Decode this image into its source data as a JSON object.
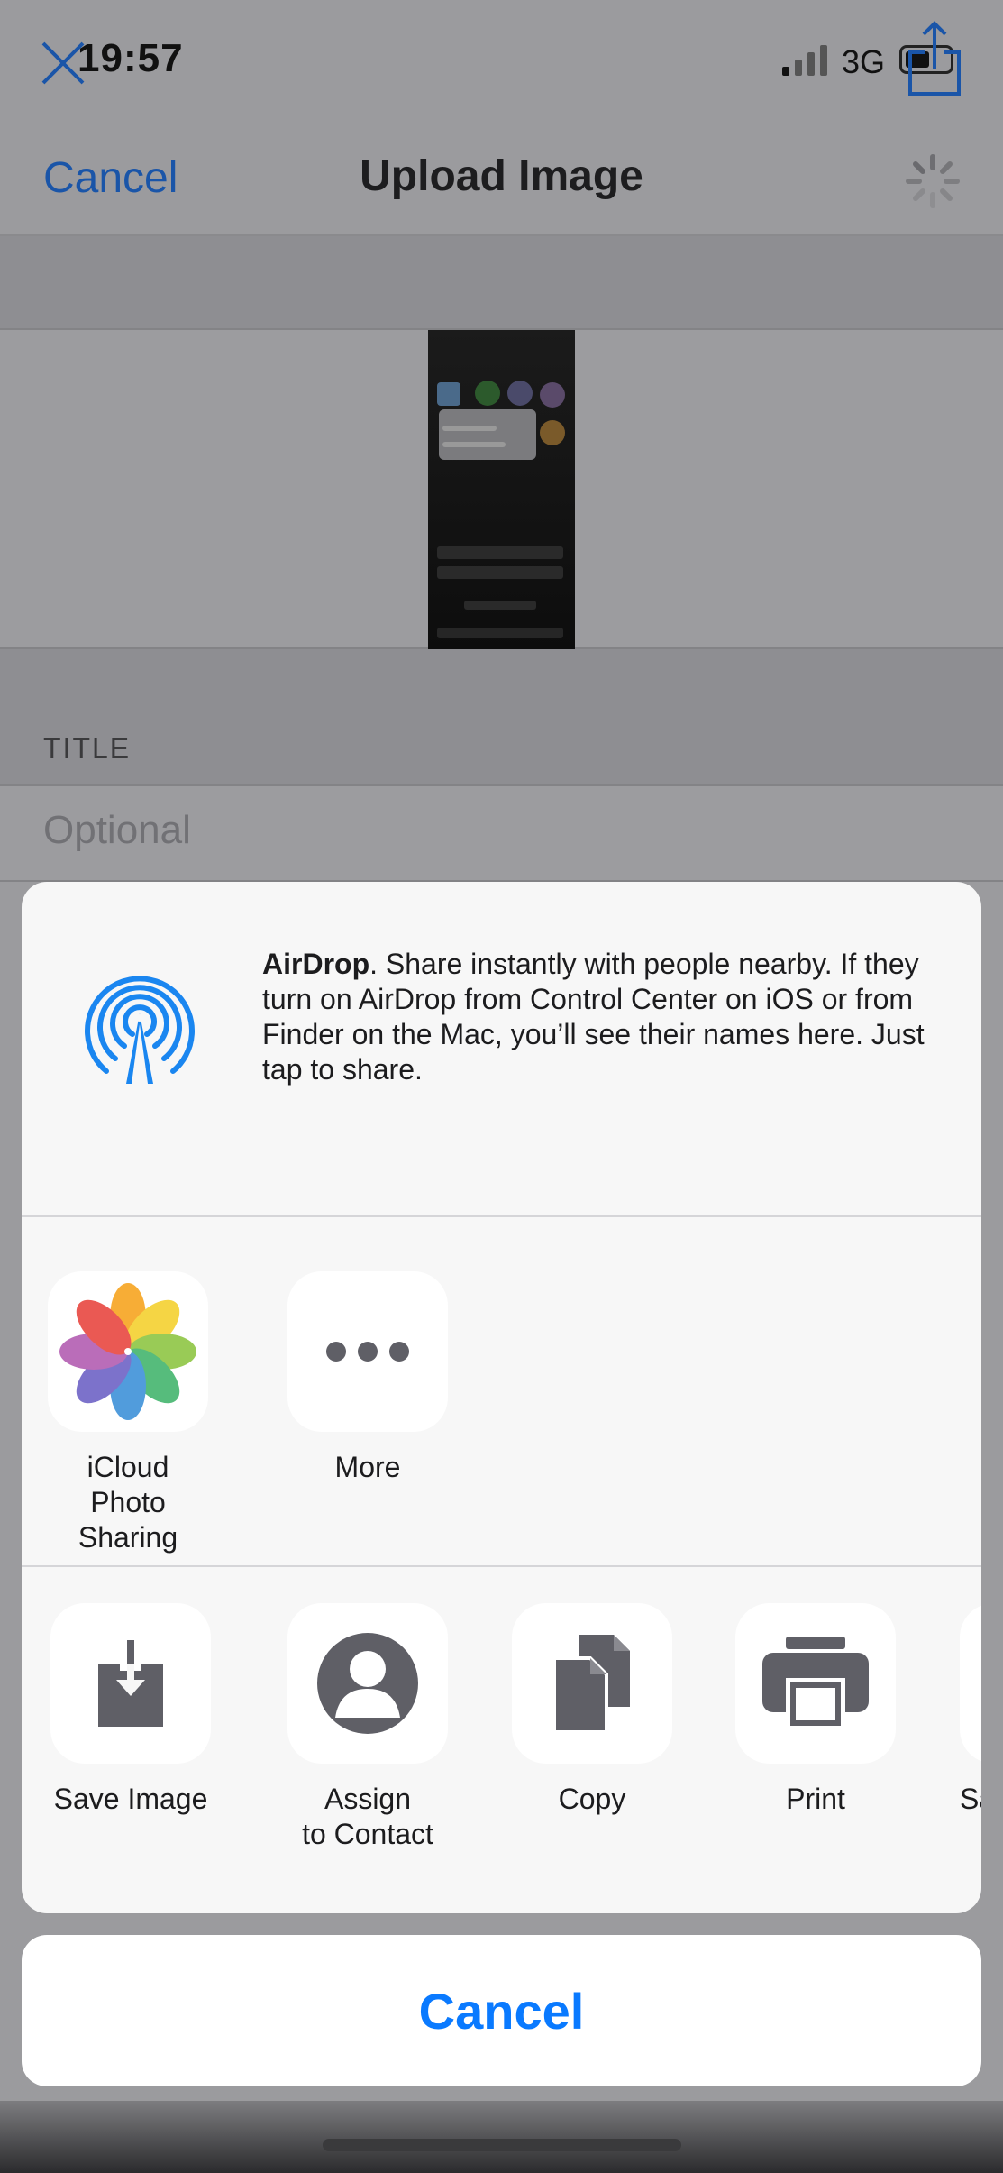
{
  "status_bar": {
    "time": "19:57",
    "network": "3G"
  },
  "nav": {
    "cancel_label": "Cancel",
    "title": "Upload Image"
  },
  "form": {
    "section_title": "TITLE",
    "title_placeholder": "Optional"
  },
  "share_sheet": {
    "airdrop": {
      "name": "AirDrop",
      "description": ". Share instantly with people nearby. If they turn on AirDrop from Control Center on iOS or from Finder on the Mac, you’ll see their names here. Just tap to share."
    },
    "apps": [
      {
        "label_line1": "iCloud Photo",
        "label_line2": "Sharing",
        "icon": "photos-icon"
      },
      {
        "label_line1": "More",
        "label_line2": "",
        "icon": "more-icon"
      }
    ],
    "actions": [
      {
        "label_line1": "Save Image",
        "label_line2": "",
        "icon": "save-image-icon"
      },
      {
        "label_line1": "Assign",
        "label_line2": "to Contact",
        "icon": "contact-icon"
      },
      {
        "label_line1": "Copy",
        "label_line2": "",
        "icon": "copy-icon"
      },
      {
        "label_line1": "Print",
        "label_line2": "",
        "icon": "print-icon"
      },
      {
        "label_line1": "Sa",
        "label_line2": "",
        "icon": "partial-action-icon"
      }
    ],
    "cancel_label": "Cancel"
  },
  "colors": {
    "ios_blue": "#0a7aff",
    "airdrop_blue": "#1a86f0",
    "action_icon_gray": "#5f5f66"
  }
}
